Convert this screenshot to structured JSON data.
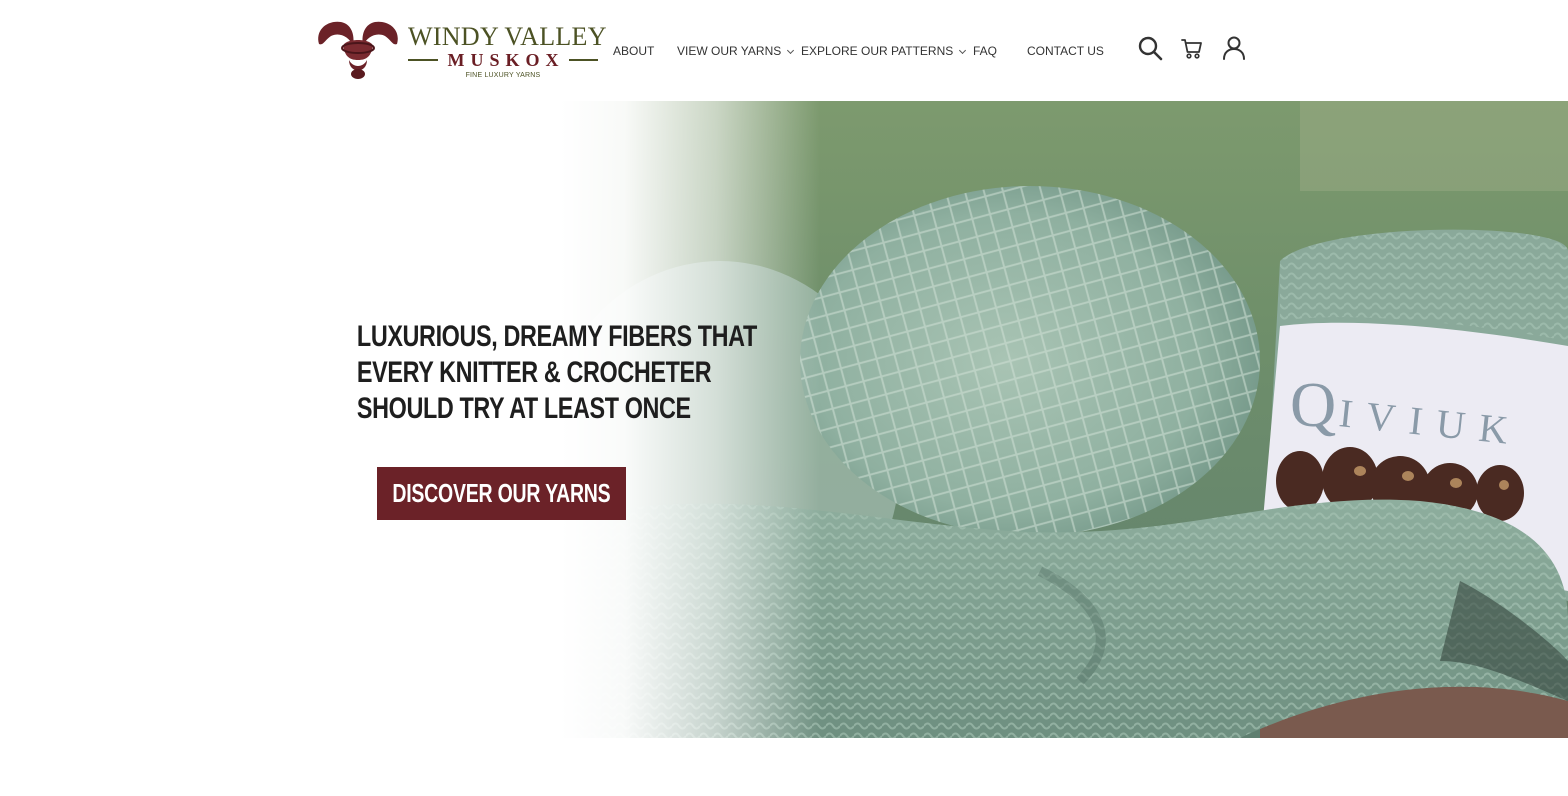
{
  "brand": {
    "name_line1": "WINDY VALLEY",
    "name_line2": "MUSKOX",
    "tagline": "FINE LUXURY YARNS",
    "colors": {
      "maroon": "#6b2228",
      "olive": "#4c5224"
    }
  },
  "nav": {
    "items": [
      {
        "label": "ABOUT",
        "has_dropdown": false
      },
      {
        "label": "VIEW OUR YARNS",
        "has_dropdown": true
      },
      {
        "label": "EXPLORE OUR PATTERNS",
        "has_dropdown": true
      },
      {
        "label": "FAQ",
        "has_dropdown": false
      },
      {
        "label": "CONTACT US",
        "has_dropdown": false
      }
    ],
    "icons": [
      "search-icon",
      "cart-icon",
      "account-icon"
    ]
  },
  "hero": {
    "heading_lines": [
      "LUXURIOUS, DREAMY FIBERS THAT",
      "EVERY KNITTER & CROCHETER",
      "SHOULD TRY AT LEAST ONCE"
    ],
    "cta_label": "DISCOVER OUR YARNS",
    "image_label_text": "QIVIUK",
    "image_description": "Sage green qiviuk yarn skeins and knitted fabric"
  }
}
